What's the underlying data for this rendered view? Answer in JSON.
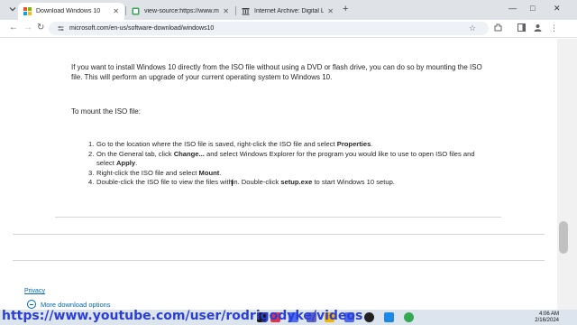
{
  "browser": {
    "tabs": [
      {
        "title": "Download Windows 10",
        "active": true,
        "favicon": "microsoft-logo"
      },
      {
        "title": "view-source:https://www.micro",
        "active": false,
        "favicon": "page-icon"
      },
      {
        "title": "Internet Archive: Digital Library",
        "active": false,
        "favicon": "archive-icon"
      }
    ],
    "new_tab": "+",
    "close": "✕",
    "address": "microsoft.com/en-us/software-download/windows10"
  },
  "page": {
    "intro_text": "If you want to install Windows 10 directly from the ISO file without using a DVD or flash drive, you can do so by mounting the ISO file. This will perform an upgrade of your current operating system to Windows 10.",
    "mount_heading": "To mount the ISO file:",
    "steps": [
      {
        "num": "1.",
        "before": "Go to the location where the ISO file is saved, right-click the ISO file and select ",
        "bold": "Properties",
        "after": "."
      },
      {
        "num": "2.",
        "before": "On the General tab, click ",
        "bold": "Change...",
        "after": " and select Windows Explorer for the program you would like to use to open ISO files and select ",
        "bold2": "Apply",
        "after2": "."
      },
      {
        "num": "3.",
        "before": "Right-click the ISO file and select ",
        "bold": "Mount",
        "after": "."
      },
      {
        "num": "4.",
        "before": "Double-click the ISO file to view the files within. Double-click ",
        "bold": "setup.exe",
        "after": " to start Windows 10 setup."
      }
    ],
    "privacy_link": "Privacy",
    "more_download": "More download options"
  },
  "overlay": {
    "url_text": "https://www.youtube.com/user/rodrigodyke/videos"
  },
  "taskbar": {
    "time": "4:06 AM",
    "date": "2/16/2024"
  },
  "colors": {
    "link": "#0067b8",
    "overlay_url": "#2b3fd6",
    "tabstrip": "#dfe3e8"
  }
}
